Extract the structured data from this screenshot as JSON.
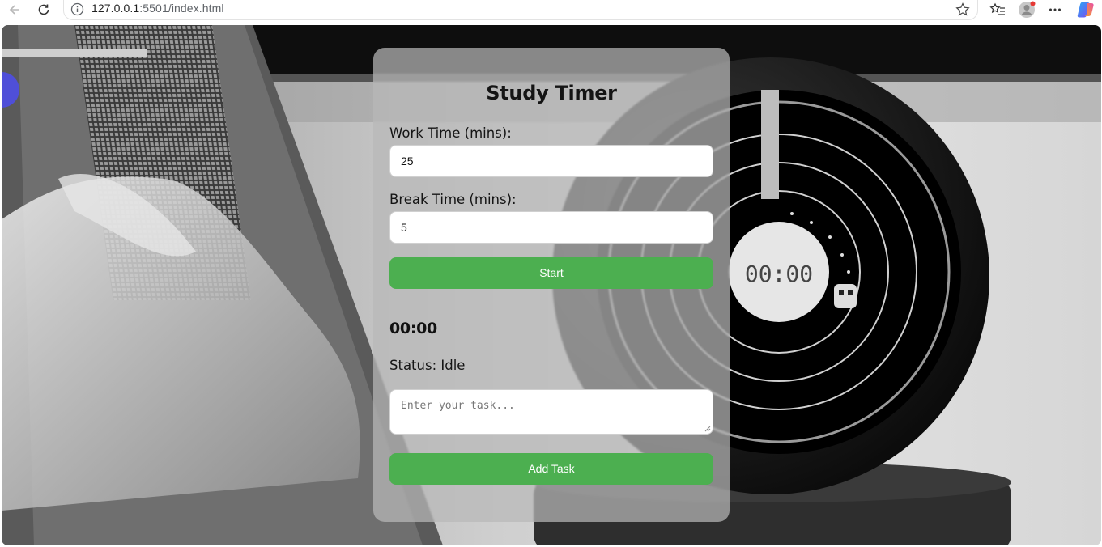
{
  "browser": {
    "url_host": "127.0.0.1",
    "url_rest": ":5501/index.html"
  },
  "app": {
    "title": "Study Timer",
    "work_label": "Work Time (mins):",
    "work_value": "25",
    "break_label": "Break Time (mins):",
    "break_value": "5",
    "start_label": "Start",
    "timer_display": "00:00",
    "status_text": "Status: Idle",
    "task_placeholder": "Enter your task...",
    "add_task_label": "Add Task",
    "bg_clock_display": "00:00"
  },
  "colors": {
    "button_green": "#4caf50"
  }
}
